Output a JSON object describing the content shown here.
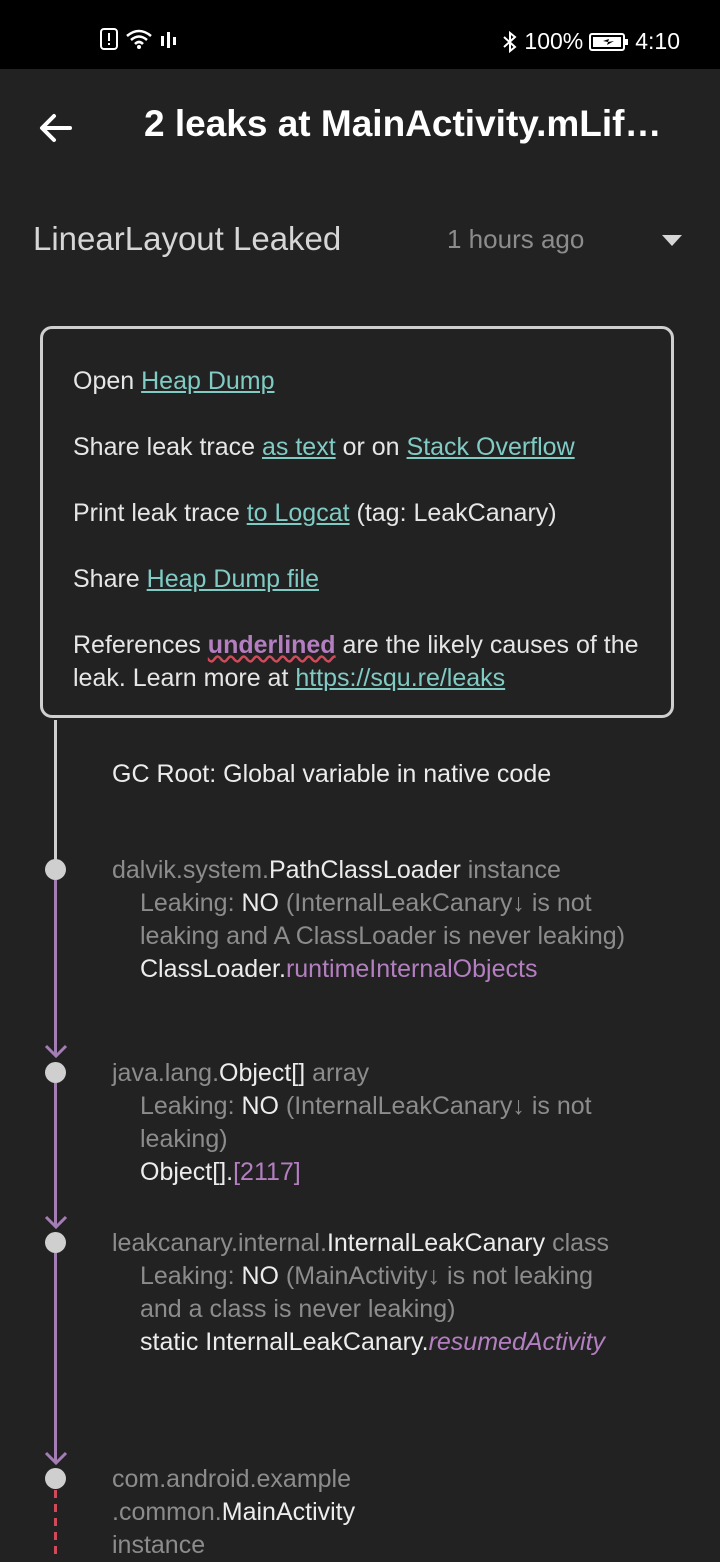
{
  "status_bar": {
    "battery": "100%",
    "time": "4:10"
  },
  "app_bar": {
    "title": "2 leaks at MainActivity.mLif…"
  },
  "leak": {
    "name": "LinearLayout Leaked",
    "time": "1 hours ago"
  },
  "info": {
    "open_prefix": "Open ",
    "heap_dump": "Heap Dump",
    "share_prefix": "Share leak trace ",
    "as_text": "as text",
    "or_on": " or on ",
    "stack_overflow": "Stack Overflow",
    "print_prefix": "Print leak trace ",
    "to_logcat": "to Logcat",
    "tag_suffix": " (tag: LeakCanary)",
    "share_file_prefix": "Share ",
    "heap_dump_file": "Heap Dump file",
    "refs_prefix": "References ",
    "underlined": "underlined",
    "refs_suffix": " are the likely causes of the leak. Learn more at ",
    "leaks_url": "https://squ.re/leaks"
  },
  "trace": {
    "root": "GC Root: Global variable in native code",
    "nodes": [
      {
        "pkg": "dalvik.system.",
        "cls": "PathClassLoader",
        "kind": " instance",
        "leaking_label": "Leaking: ",
        "leaking_value": "NO",
        "reason": " (InternalLeakCanary↓ is not leaking and A ClassLoader is never leaking)",
        "ref_owner": "ClassLoader.",
        "ref_field": "runtimeInternalObjects"
      },
      {
        "pkg": "java.lang.",
        "cls": "Object[]",
        "kind": " array",
        "leaking_label": "Leaking: ",
        "leaking_value": "NO",
        "reason": " (InternalLeakCanary↓ is not leaking)",
        "ref_owner": "Object[].",
        "ref_field": "[2117]"
      },
      {
        "pkg": "leakcanary.internal.",
        "cls": "InternalLeakCanary",
        "kind": " class",
        "leaking_label": "Leaking: ",
        "leaking_value": "NO",
        "reason": " (MainActivity↓ is not leaking and a class is never leaking)",
        "ref_owner": "static InternalLeakCanary.",
        "ref_field": "resumedActivity"
      },
      {
        "pkg": "com.android.example .common.",
        "cls": "MainActivity",
        "kind": " instance"
      }
    ]
  }
}
